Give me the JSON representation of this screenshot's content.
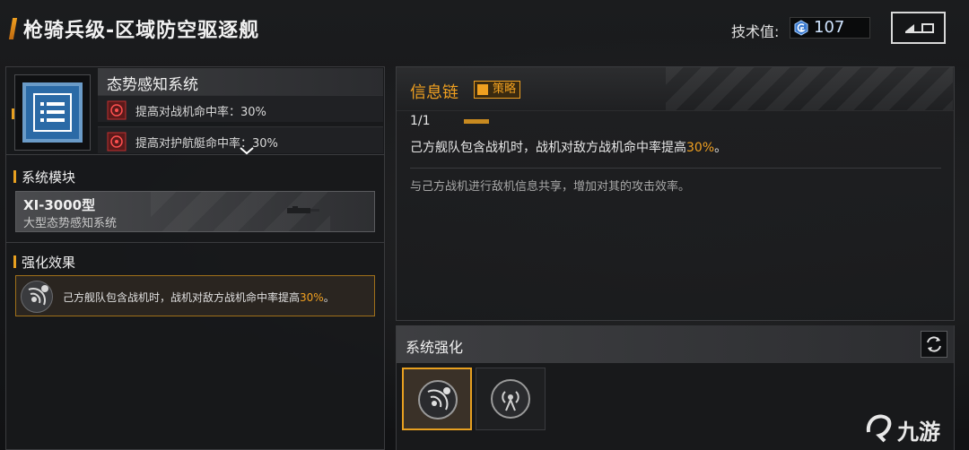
{
  "header": {
    "title": "枪骑兵级-区域防空驱逐舰",
    "tech_label": "技术值:",
    "tech_value": "107",
    "back_icon": "back-arrow-icon"
  },
  "system_card": {
    "name": "态势感知系统",
    "icon": "list-icon",
    "effects": [
      {
        "text": "提高对战机命中率：30%",
        "icon": "target-icon"
      },
      {
        "text": "提高对护航艇命中率：30%",
        "icon": "target-icon"
      }
    ]
  },
  "system_module": {
    "heading": "系统模块",
    "name": "XI-3000型",
    "desc": "大型态势感知系统"
  },
  "enhancement_effect": {
    "heading": "强化效果",
    "text_prefix": "己方舰队包含战机时，战机对敌方战机命中率提高",
    "text_highlight": "30%",
    "text_suffix": "。"
  },
  "info_panel": {
    "title": "信息链",
    "tag": "策略",
    "level": "1/1",
    "effect_prefix": "己方舰队包含战机时，战机对敌方战机命中率提高",
    "effect_highlight": "30%",
    "effect_suffix": "。",
    "description": "与己方战机进行敌机信息共享，增加对其的攻击效率。"
  },
  "system_enhancement": {
    "heading": "系统强化",
    "refresh_icon": "refresh-icon",
    "slots": [
      {
        "icon": "signal-plus-icon",
        "selected": true
      },
      {
        "icon": "antenna-icon",
        "selected": false
      }
    ]
  },
  "watermark": {
    "text": "九游"
  },
  "colors": {
    "accent": "#f0a020",
    "panel_border": "#3a3b3e",
    "icon_blue": "#2b6aa6"
  }
}
